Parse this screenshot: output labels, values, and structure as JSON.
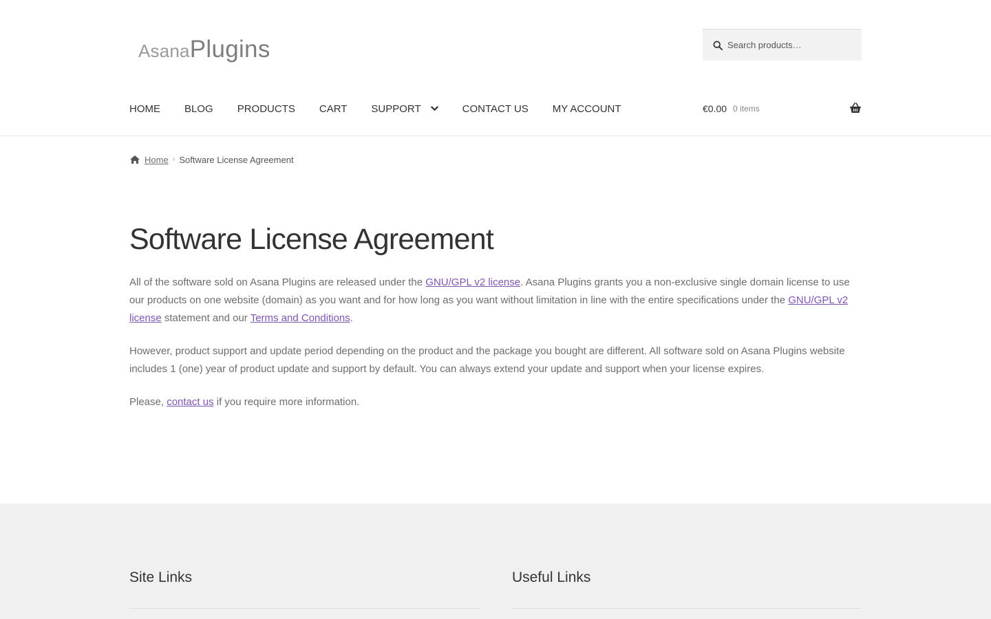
{
  "logo": {
    "light": "Asana",
    "bold": "Plugins"
  },
  "search": {
    "placeholder": "Search products…"
  },
  "nav": {
    "items": [
      "HOME",
      "BLOG",
      "PRODUCTS",
      "CART",
      "SUPPORT",
      "CONTACT US",
      "MY ACCOUNT"
    ]
  },
  "cart": {
    "amount": "€0.00",
    "count": "0 items"
  },
  "breadcrumb": {
    "home": "Home",
    "current": "Software License Agreement"
  },
  "page": {
    "title": "Software License Agreement",
    "p1": {
      "t1": "All of the software sold on Asana Plugins are released under the ",
      "link1": "GNU/GPL v2 license",
      "t2": ". Asana Plugins grants you a non-exclusive single domain license to use our products on one website (domain) as you want and for how long as you want without limitation in line with the entire specifications under the ",
      "link2": "GNU/GPL v2 license",
      "t3": " statement and our ",
      "link3": "Terms and Conditions",
      "t4": "."
    },
    "p2": "However, product support and update period depending on the product and the package you bought are different. All software sold on Asana Plugins website includes 1 (one) year of product update and support by default. You can always extend your update and support when your license expires.",
    "p3": {
      "t1": "Please, ",
      "link": "contact us",
      "t2": " if you require more information."
    }
  },
  "footer": {
    "col1_title": "Site Links",
    "col2_title": "Useful Links"
  },
  "colors": {
    "link": "#7f54b3",
    "heading": "#333333",
    "body_text": "#6d6d6d",
    "footer_bg": "#f0f0f0"
  }
}
